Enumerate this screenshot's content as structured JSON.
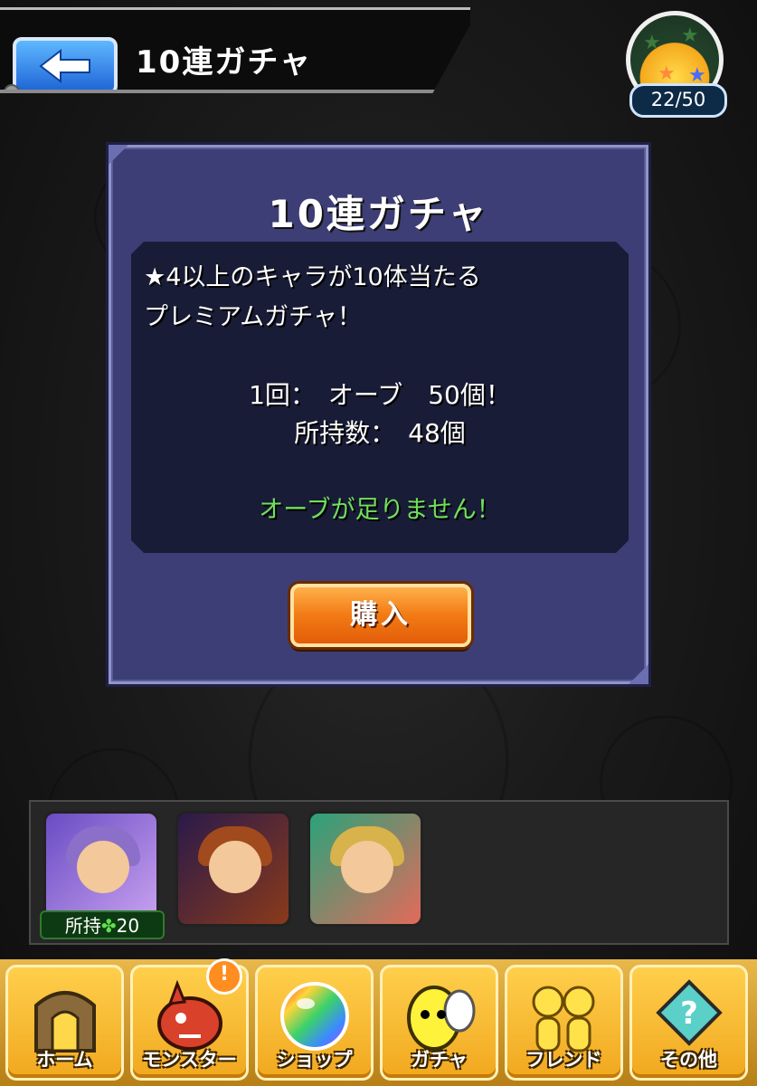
{
  "header": {
    "title": "10連ガチャ",
    "stamina": "22/50"
  },
  "dialog": {
    "title": "10連ガチャ",
    "description_line1": "★4以上のキャラが10体当たる",
    "description_line2": "プレミアムガチャ！",
    "cost_line": "1回：　オーブ　50個！",
    "owned_line": "所持数：　48個",
    "warning": "オーブが足りません！",
    "buy_label": "購入"
  },
  "characters": {
    "owned_label": "所持",
    "owned_count": "20"
  },
  "nav": {
    "items": [
      {
        "label": "ホーム",
        "icon": "gate-icon"
      },
      {
        "label": "モンスター",
        "icon": "monster-icon",
        "alert": "!"
      },
      {
        "label": "ショップ",
        "icon": "rainbow-orb-icon"
      },
      {
        "label": "ガチャ",
        "icon": "egg-icon"
      },
      {
        "label": "フレンド",
        "icon": "friends-icon"
      },
      {
        "label": "その他",
        "icon": "question-icon"
      }
    ]
  },
  "colors": {
    "dialog_bg": "#3d3e76",
    "info_box_bg": "#191c36",
    "warning_green": "#6fe05c",
    "buy_orange": "#f27a14",
    "nav_gold": "#f1a81f"
  }
}
